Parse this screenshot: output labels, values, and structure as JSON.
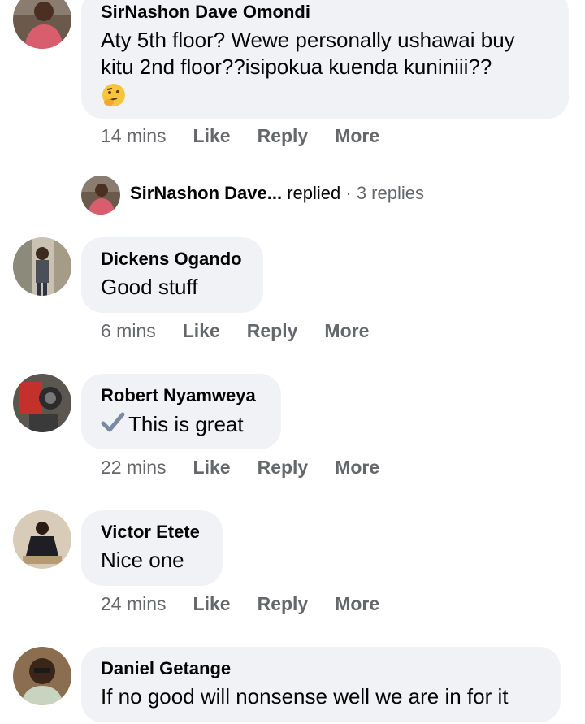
{
  "comments": [
    {
      "author": "SirNashon Dave Omondi",
      "text_line1": "Aty 5th floor? Wewe personally ushawai buy",
      "text_line2": "kitu 2nd floor??isipokua kuenda kuniniii??",
      "time": "14 mins",
      "like": "Like",
      "reply": "Reply",
      "more": "More"
    },
    {
      "author": "Dickens Ogando",
      "text": "Good stuff",
      "time": "6 mins",
      "like": "Like",
      "reply": "Reply",
      "more": "More"
    },
    {
      "author": "Robert Nyamweya",
      "text": "This is great",
      "time": "22 mins",
      "like": "Like",
      "reply": "Reply",
      "more": "More"
    },
    {
      "author": "Victor Etete",
      "text": "Nice one",
      "time": "24 mins",
      "like": "Like",
      "reply": "Reply",
      "more": "More"
    },
    {
      "author": "Daniel Getange",
      "text": "If no good will nonsense well we are in for it"
    }
  ],
  "replies_summary": {
    "name": "SirNashon Dave...",
    "verb": "replied",
    "separator": "·",
    "count": "3 replies"
  },
  "icons": {
    "thinking": "thinking-face-emoji",
    "check": "heavy-check-mark-emoji"
  }
}
